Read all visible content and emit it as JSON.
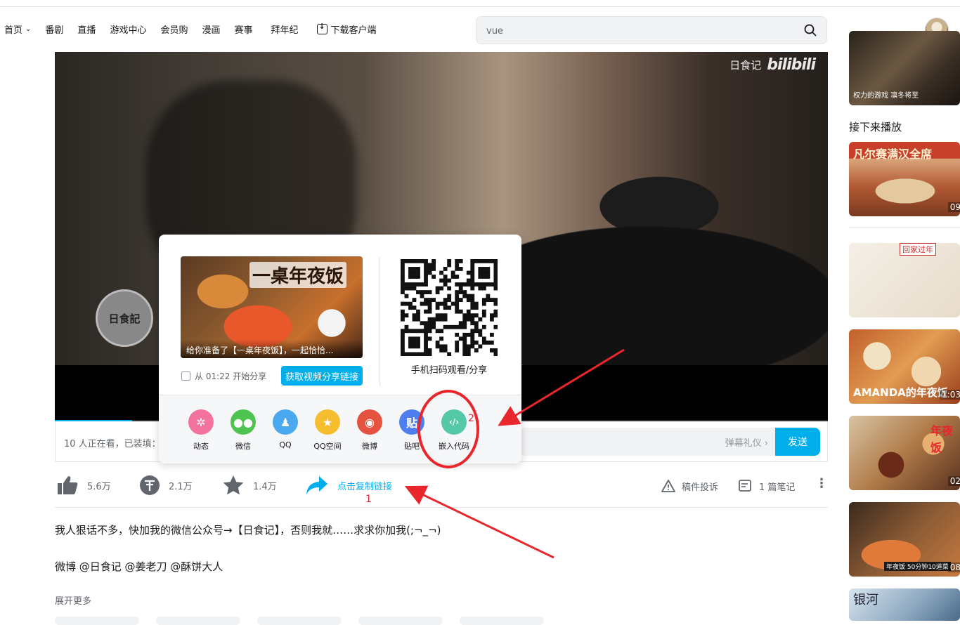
{
  "nav": {
    "items": [
      "首页",
      "番剧",
      "直播",
      "游戏中心",
      "会员购",
      "漫画",
      "赛事",
      "拜年纪"
    ],
    "download": "下载客户端"
  },
  "search": {
    "value": "vue"
  },
  "video": {
    "watermark_text": "日食记",
    "watermark_logo": "bilibili",
    "up_logo_text": "日食記",
    "progress_fraction": 0.1
  },
  "danmaku": {
    "viewers_text": "10 人正在看，已装填：",
    "etiquette": "弹幕礼仪 ›",
    "send": "发送"
  },
  "share_popup": {
    "thumb_title": "一桌年夜饭",
    "thumb_caption": "给你准备了【一桌年夜饭】，一起恰恰...",
    "from_time_label": "从 01:22 开始分享",
    "get_link_button": "获取视频分享链接",
    "qr_label": "手机扫码观看/分享",
    "items": [
      {
        "label": "动态",
        "icon": "dynamic-icon",
        "color": "#f4729e",
        "glyph": "✲"
      },
      {
        "label": "微信",
        "icon": "wechat-icon",
        "color": "#4fc34f",
        "glyph": "●●"
      },
      {
        "label": "QQ",
        "icon": "qq-icon",
        "color": "#4aa8ee",
        "glyph": "♟"
      },
      {
        "label": "QQ空间",
        "icon": "qzone-icon",
        "color": "#f6bd2f",
        "glyph": "★"
      },
      {
        "label": "微博",
        "icon": "weibo-icon",
        "color": "#e5523f",
        "glyph": "◉"
      },
      {
        "label": "贴吧",
        "icon": "tieba-icon",
        "color": "#4e7ef0",
        "glyph": "贴"
      },
      {
        "label": "嵌入代码",
        "icon": "embed-code-icon",
        "color": "#55c8a8",
        "glyph": "‹/›"
      }
    ]
  },
  "annotations": {
    "num1": "1",
    "num2": "2",
    "color": "#e8262c"
  },
  "toolbar": {
    "like": "5.6万",
    "coin": "2.1万",
    "favorite": "1.4万",
    "copy_link": "点击复制链接",
    "report": "稿件投诉",
    "notes": "1 篇笔记"
  },
  "description": {
    "line1": "我人狠话不多，快加我的微信公众号→【日食记】，否则我就……求求你加我(;¬_¬)",
    "line2": "微博 @日食记 @姜老刀 @酥饼大人",
    "expand": "展开更多"
  },
  "sidebar": {
    "top_caption": "权力的游戏 凛冬将至",
    "next_title": "接下来播放",
    "videos": [
      {
        "cover_text": "凡尔赛满汉全席",
        "duration": "09"
      },
      {
        "cover_text": "回家过年",
        "duration": ""
      },
      {
        "cover_text": "AMANDA的年夜饭",
        "duration": "1:03"
      },
      {
        "cover_text": "年夜饭",
        "duration": "02"
      },
      {
        "cover_text": "年夜饭 50分钟10道菜",
        "duration": "08"
      },
      {
        "cover_text": "银河",
        "duration": ""
      }
    ]
  },
  "colors": {
    "accent": "#00aeec",
    "annotation": "#e8262c"
  }
}
